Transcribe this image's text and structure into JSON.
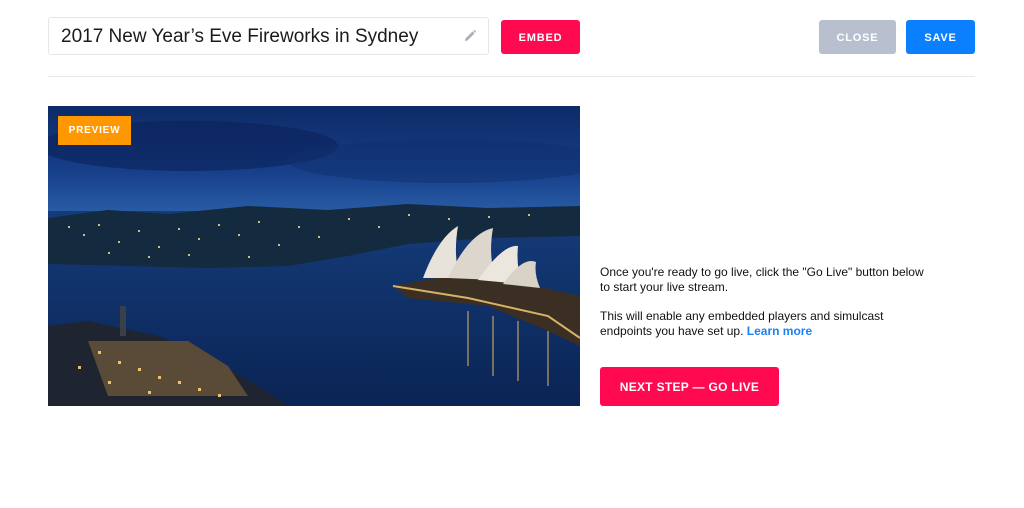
{
  "header": {
    "stream_title": "2017 New Year’s Eve Fireworks in Sydney",
    "embed_label": "EMBED",
    "close_label": "CLOSE",
    "save_label": "SAVE"
  },
  "preview": {
    "badge_label": "PREVIEW"
  },
  "info": {
    "paragraph_1": "Once you're ready to go live, click the \"Go Live\" button below to start your live stream.",
    "paragraph_2": "This will enable any embedded players and simulcast endpoints you have set up.",
    "learn_more_label": "Learn more"
  },
  "actions": {
    "go_live_label": "NEXT STEP — GO LIVE"
  },
  "colors": {
    "accent_pink": "#ff0a50",
    "save_blue": "#0b80ff",
    "close_gray": "#b8c0cf",
    "preview_orange": "#ff9800",
    "link_blue": "#1a82f7"
  },
  "icons": {
    "title_edit": "pencil-icon"
  }
}
